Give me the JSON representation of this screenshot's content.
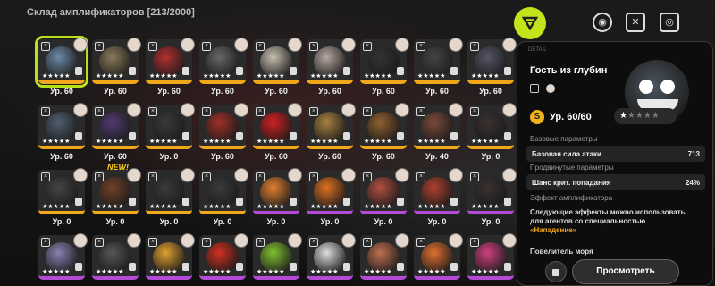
{
  "header": {
    "title": "Склад амплификаторов [213/2000]"
  },
  "tabs": [
    {
      "icon": "amplifier-icon",
      "active": true
    },
    {
      "icon": "disc-icon",
      "active": false
    },
    {
      "icon": "box-icon",
      "active": false
    },
    {
      "icon": "manual-icon",
      "active": false
    }
  ],
  "grid": {
    "items": [
      {
        "level": "Ур. 60",
        "rarity": "gold",
        "selected": true,
        "art": "#6b8aa6"
      },
      {
        "level": "Ур. 60",
        "rarity": "gold",
        "art": "#8a7a5a"
      },
      {
        "level": "Ур. 60",
        "rarity": "gold",
        "art": "#b03030"
      },
      {
        "level": "Ур. 60",
        "rarity": "gold",
        "art": "#666"
      },
      {
        "level": "Ур. 60",
        "rarity": "gold",
        "art": "#c8c0b0"
      },
      {
        "level": "Ур. 60",
        "rarity": "gold",
        "art": "#b8a8a0"
      },
      {
        "level": "Ур. 60",
        "rarity": "gold",
        "art": "#333"
      },
      {
        "level": "Ур. 60",
        "rarity": "gold",
        "art": "#444"
      },
      {
        "level": "Ур. 60",
        "rarity": "gold",
        "art": "#556"
      },
      {
        "level": "Ур. 60",
        "rarity": "gold",
        "art": "#506070"
      },
      {
        "level": "Ур. 60",
        "rarity": "gold",
        "art": "#503a70"
      },
      {
        "level": "Ур. 0",
        "rarity": "gold",
        "art": "#3a3a3a"
      },
      {
        "level": "Ур. 60",
        "rarity": "gold",
        "art": "#a03028"
      },
      {
        "level": "Ур. 60",
        "rarity": "gold",
        "art": "#d02020"
      },
      {
        "level": "Ур. 60",
        "rarity": "gold",
        "art": "#a88040"
      },
      {
        "level": "Ур. 60",
        "rarity": "gold",
        "art": "#906030"
      },
      {
        "level": "Ур. 40",
        "rarity": "gold",
        "art": "#7a4a3a"
      },
      {
        "level": "Ур. 0",
        "rarity": "gold",
        "art": "#3a3030"
      },
      {
        "level": "Ур. 0",
        "rarity": "gold",
        "art": "#444"
      },
      {
        "level": "Ур. 0",
        "rarity": "gold",
        "new": "NEW!",
        "art": "#704028"
      },
      {
        "level": "Ур. 0",
        "rarity": "gold",
        "art": "#3a3a3a"
      },
      {
        "level": "Ур. 0",
        "rarity": "gold",
        "art": "#3a3a3a"
      },
      {
        "level": "Ур. 0",
        "rarity": "purple",
        "art": "#e08030"
      },
      {
        "level": "Ур. 0",
        "rarity": "purple",
        "art": "#e07020"
      },
      {
        "level": "Ур. 0",
        "rarity": "purple",
        "art": "#b05040"
      },
      {
        "level": "Ур. 0",
        "rarity": "purple",
        "art": "#b04030"
      },
      {
        "level": "Ур. 0",
        "rarity": "purple",
        "art": "#3a3030"
      },
      {
        "level": "",
        "rarity": "purple",
        "art": "#8a80b0"
      },
      {
        "level": "",
        "rarity": "purple",
        "art": "#555"
      },
      {
        "level": "",
        "rarity": "purple",
        "art": "#e0a030"
      },
      {
        "level": "",
        "rarity": "purple",
        "art": "#d03020"
      },
      {
        "level": "",
        "rarity": "purple",
        "art": "#80c030"
      },
      {
        "level": "",
        "rarity": "purple",
        "art": "#ddd"
      },
      {
        "level": "",
        "rarity": "purple",
        "art": "#c07050"
      },
      {
        "level": "",
        "rarity": "purple",
        "art": "#e07030"
      },
      {
        "level": "",
        "rarity": "purple",
        "art": "#d04080"
      }
    ]
  },
  "detail": {
    "tag": "DETAIL",
    "name": "Гость из глубин",
    "level_coin": "S",
    "level": "Ур. 60/60",
    "stars": "★★★★★",
    "base_section": "Базовые параметры",
    "base_stat_label": "Базовая сила атаки",
    "base_stat_value": "713",
    "adv_section": "Продвинутые параметры",
    "adv_stat_label": "Шанс крит. попадания",
    "adv_stat_value": "24%",
    "effect_section": "Эффект амплификатора",
    "effect_text": "Следующие эффекты можно использовать для агентов со специальностью",
    "effect_highlight": "«Нападение»",
    "effect_name": "Повелитель моря",
    "view_button": "Просмотреть"
  },
  "colors": {
    "accent": "#c3e41b",
    "gold": "#f0a81a",
    "purple": "#b44ad6"
  }
}
